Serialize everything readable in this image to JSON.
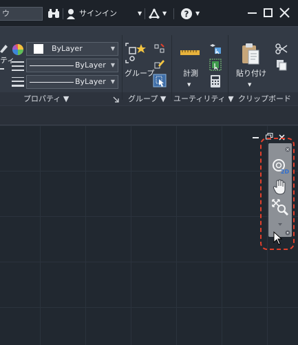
{
  "titlebar": {
    "search_text": "ウ",
    "signin_label": "サインイン",
    "window_controls": [
      "minimize",
      "maximize",
      "close"
    ]
  },
  "ribbon": {
    "properties": {
      "partial_label": "ティ",
      "bylayer_color": "ByLayer",
      "bylayer_linetype": "ByLayer",
      "bylayer_lineweight": "ByLayer",
      "panel_title": "プロパティ ▼"
    },
    "group": {
      "button_label": "グループ",
      "panel_title": "グループ ▼"
    },
    "utility": {
      "measure_label": "計測",
      "panel_title": "ユーティリティ ▼"
    },
    "clipboard": {
      "paste_label": "貼り付け",
      "panel_title": "クリップボード"
    }
  },
  "navbar": {
    "tools": [
      "steeringwheel-2d",
      "pan",
      "zoom-extents"
    ],
    "highlight_color": "#e2402c"
  },
  "colors": {
    "canvas_bg": "#212830",
    "ribbon_bg": "#333a45",
    "titlebar_bg": "#1d2229"
  }
}
